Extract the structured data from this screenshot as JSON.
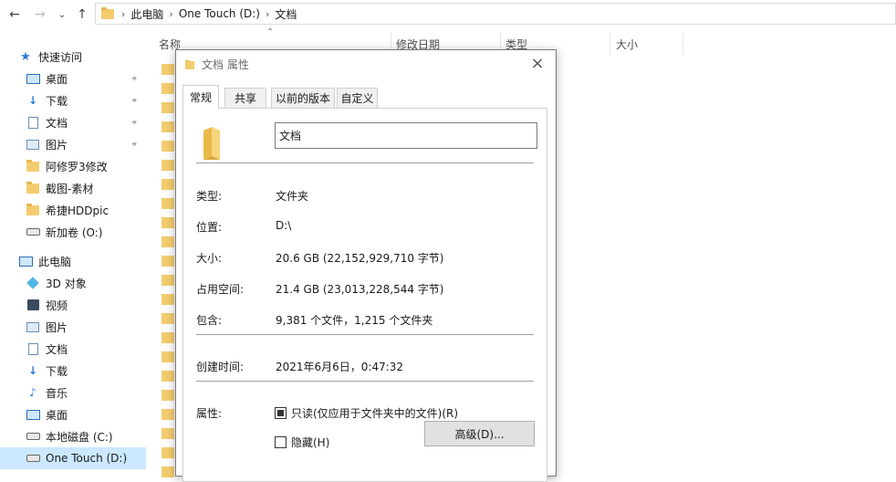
{
  "address": {
    "crumbs": [
      "此电脑",
      "One Touch (D:)",
      "文档"
    ]
  },
  "columns": {
    "name": "名称",
    "modified": "修改日期",
    "type": "类型",
    "size": "大小"
  },
  "sidebar": {
    "quick_access": "快速访问",
    "quick_items": [
      {
        "label": "桌面",
        "icon": "desktop-icon"
      },
      {
        "label": "下载",
        "icon": "download-icon"
      },
      {
        "label": "文档",
        "icon": "document-icon"
      },
      {
        "label": "图片",
        "icon": "picture-icon"
      },
      {
        "label": "阿修罗3修改",
        "icon": "folder-icon"
      },
      {
        "label": "截图-素材",
        "icon": "folder-icon"
      },
      {
        "label": "希捷HDDpic",
        "icon": "folder-icon"
      },
      {
        "label": "新加卷 (O:)",
        "icon": "drive-icon"
      }
    ],
    "this_pc": "此电脑",
    "pc_items": [
      {
        "label": "3D 对象",
        "icon": "3d-objects-icon"
      },
      {
        "label": "视频",
        "icon": "video-icon"
      },
      {
        "label": "图片",
        "icon": "picture-icon"
      },
      {
        "label": "文档",
        "icon": "document-icon"
      },
      {
        "label": "下载",
        "icon": "download-icon"
      },
      {
        "label": "音乐",
        "icon": "music-icon"
      },
      {
        "label": "桌面",
        "icon": "desktop-icon"
      },
      {
        "label": "本地磁盘 (C:)",
        "icon": "drive-icon"
      },
      {
        "label": "One Touch (D:)",
        "icon": "drive-icon"
      }
    ]
  },
  "dialog": {
    "title": "文档 属性",
    "tabs": [
      "常规",
      "共享",
      "以前的版本",
      "自定义"
    ],
    "folder_name": "文档",
    "type_label": "类型:",
    "type_value": "文件夹",
    "location_label": "位置:",
    "location_value": "D:\\",
    "size_label": "大小:",
    "size_value": "20.6 GB (22,152,929,710 字节)",
    "disk_size_label": "占用空间:",
    "disk_size_value": "21.4 GB (23,013,228,544 字节)",
    "contains_label": "包含:",
    "contains_value": "9,381 个文件，1,215 个文件夹",
    "created_label": "创建时间:",
    "created_value": "2021年6月6日，0:47:32",
    "attributes_label": "属性:",
    "readonly_label": "只读(仅应用于文件夹中的文件)(R)",
    "hidden_label": "隐藏(H)",
    "advanced_button": "高级(D)..."
  }
}
